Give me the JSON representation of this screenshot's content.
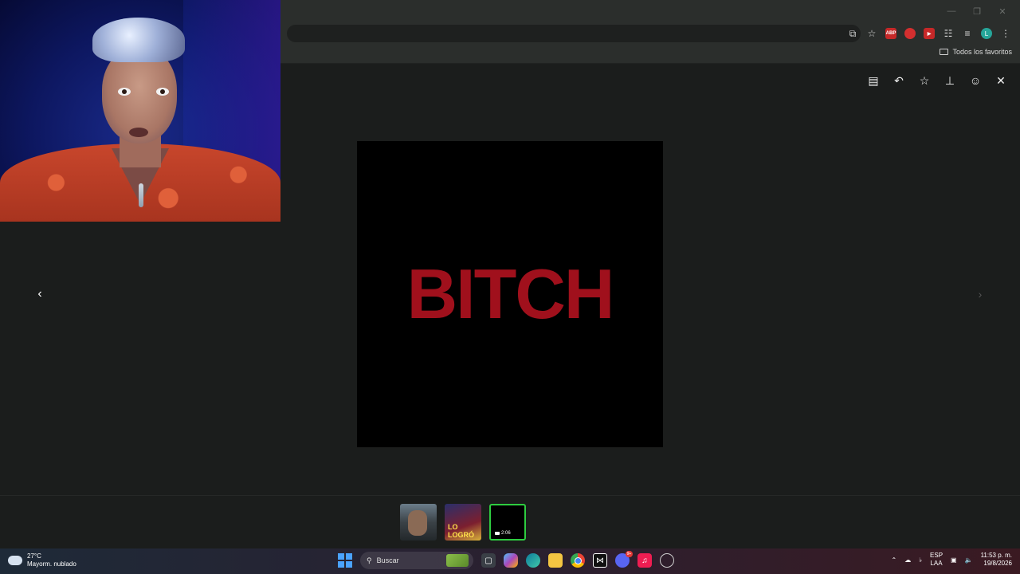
{
  "browser": {
    "bookmarks": {
      "all_label": "Todos los favoritos"
    },
    "profile_initial": "L",
    "extensions": {
      "abp": "ABP"
    }
  },
  "viewer": {
    "actions": [
      "caption-icon",
      "reply-icon",
      "star-icon",
      "pin-icon",
      "emoji-icon",
      "close-icon"
    ],
    "media_text": "BITCH",
    "media_text_color": "#a0101c",
    "thumbnails": [
      {
        "kind": "image"
      },
      {
        "kind": "image",
        "text": "LO LOGRÓ"
      },
      {
        "kind": "video",
        "duration": "2:06",
        "selected": true
      }
    ],
    "selected_border_color": "#2ecc40"
  },
  "taskbar": {
    "weather": {
      "temp": "27°C",
      "condition": "Mayorm. nublado"
    },
    "search_placeholder": "Buscar",
    "discord_badge": "9+",
    "language": {
      "lang": "ESP",
      "layout": "LAA"
    },
    "clock": {
      "time": "11:53 p. m.",
      "date": "19/8/2026"
    }
  }
}
